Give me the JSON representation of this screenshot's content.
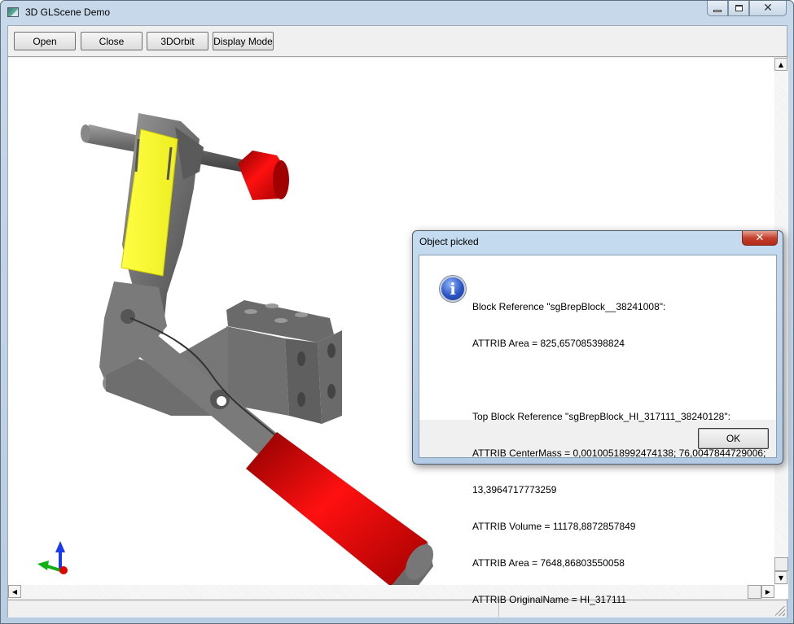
{
  "window": {
    "title": "3D GLScene Demo",
    "caption_buttons": [
      "minimize",
      "maximize",
      "close"
    ]
  },
  "toolbar": {
    "buttons": [
      {
        "label": "Open"
      },
      {
        "label": "Close"
      },
      {
        "label": "3DOrbit"
      },
      {
        "label": "Display Mode"
      }
    ]
  },
  "viewport": {
    "scene": "3D CAD model of a toggle clamp",
    "selected_part_color": "#ffff33",
    "handle_color": "#e00000",
    "body_color": "#777777",
    "axes_icon": [
      "x-red",
      "y-green",
      "z-blue"
    ]
  },
  "statusbar": {
    "panels": [
      "",
      ""
    ]
  },
  "dialog": {
    "title": "Object picked",
    "icon": "info-icon",
    "message_lines": [
      "Block Reference \"sgBrepBlock__38241008\":",
      "ATTRIB Area = 825,657085398824",
      "",
      "Top Block Reference \"sgBrepBlock_HI_317111_38240128\":",
      "ATTRIB CenterMass = 0,00100518992474138; 76,0047844729006;",
      "13,3964717773259",
      "ATTRIB Volume = 11178,8872857849",
      "ATTRIB Area = 7648,86803550058",
      "ATTRIB OriginalName = HI_317111"
    ],
    "ok_label": "OK"
  }
}
